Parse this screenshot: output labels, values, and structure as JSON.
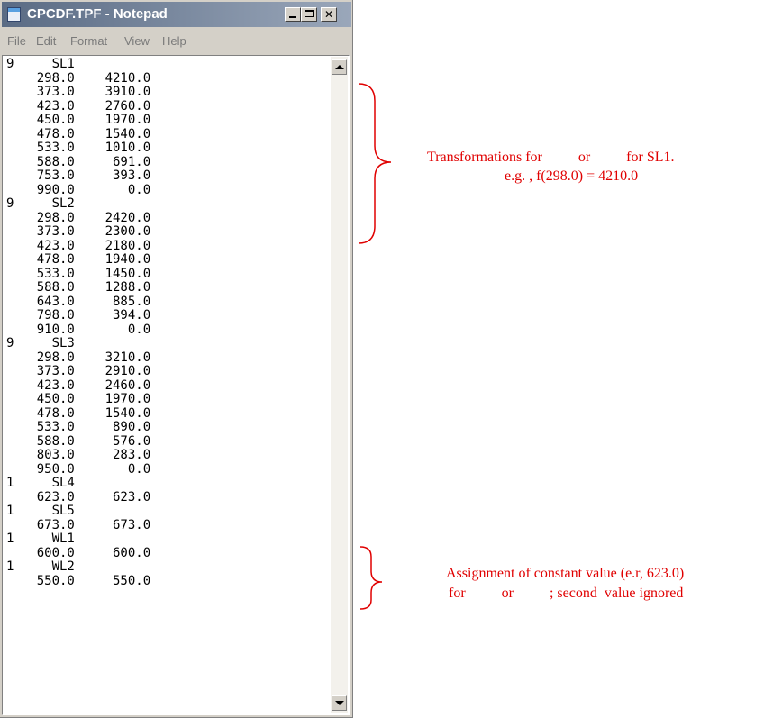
{
  "window": {
    "title": "CPCDF.TPF - Notepad",
    "menu": [
      "File",
      "Edit",
      "Format",
      "View",
      "Help"
    ]
  },
  "document": {
    "lines": [
      "9     SL1",
      "    298.0    4210.0",
      "    373.0    3910.0",
      "    423.0    2760.0",
      "    450.0    1970.0",
      "    478.0    1540.0",
      "    533.0    1010.0",
      "    588.0     691.0",
      "    753.0     393.0",
      "    990.0       0.0",
      "9     SL2",
      "    298.0    2420.0",
      "    373.0    2300.0",
      "    423.0    2180.0",
      "    478.0    1940.0",
      "    533.0    1450.0",
      "    588.0    1288.0",
      "    643.0     885.0",
      "    798.0     394.0",
      "    910.0       0.0",
      "9     SL3",
      "    298.0    3210.0",
      "    373.0    2910.0",
      "    423.0    2460.0",
      "    450.0    1970.0",
      "    478.0    1540.0",
      "    533.0     890.0",
      "    588.0     576.0",
      "    803.0     283.0",
      "    950.0       0.0",
      "1     SL4",
      "    623.0     623.0",
      "1     SL5",
      "    673.0     673.0",
      "1     WL1",
      "    600.0     600.0",
      "1     WL2",
      "    550.0     550.0"
    ]
  },
  "annotations": {
    "transform_line1": "Transformations for          or          for SL1.",
    "transform_line2": "e.g. , f(298.0) = 4210.0",
    "assign_line1": "Assignment of constant value (e.r, 623.0)",
    "assign_line2": "for          or          ; second  value ignored",
    "color": "#e00000"
  }
}
